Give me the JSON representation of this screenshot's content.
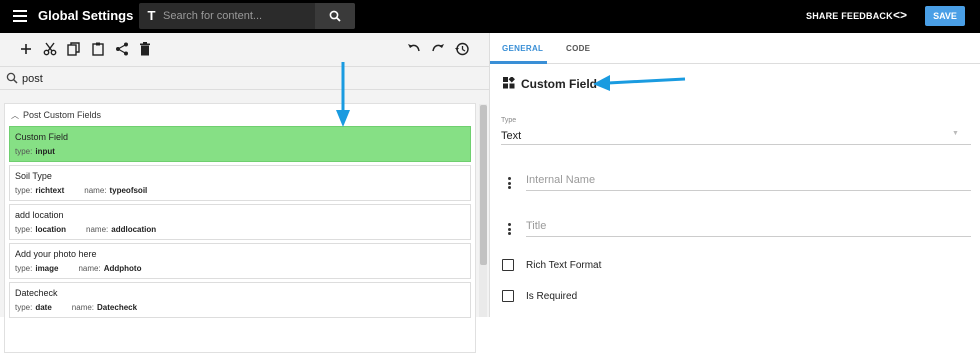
{
  "header": {
    "title": "Global Settings",
    "search_placeholder": "Search for content...",
    "share_feedback": "SHARE FEEDBACK",
    "code_toggle": "<>",
    "save_label": "SAVE"
  },
  "toolbar": {
    "icons": [
      "add-icon",
      "cut-icon",
      "copy-icon",
      "paste-icon",
      "share-icon",
      "delete-icon",
      "undo-icon",
      "redo-icon",
      "history-icon"
    ]
  },
  "filter": {
    "value": "post"
  },
  "tree": {
    "group_label": "Post Custom Fields",
    "type_key": "type:",
    "name_key": "name:",
    "items": [
      {
        "label": "Custom Field",
        "type": "input",
        "name": ""
      },
      {
        "label": "Soil Type",
        "type": "richtext",
        "name": "typeofsoil"
      },
      {
        "label": "add location",
        "type": "location",
        "name": "addlocation"
      },
      {
        "label": "Add your photo here",
        "type": "image",
        "name": "Addphoto"
      },
      {
        "label": "Datecheck",
        "type": "date",
        "name": "Datecheck"
      }
    ]
  },
  "details": {
    "tabs": [
      {
        "label": "GENERAL",
        "active": true
      },
      {
        "label": "CODE",
        "active": false
      }
    ],
    "title": "Custom Field",
    "type_label": "Type",
    "type_value": "Text",
    "internal_name_placeholder": "Internal Name",
    "title_placeholder": "Title",
    "rich_text_label": "Rich Text Format",
    "is_required_label": "Is Required"
  },
  "colors": {
    "accent": "#3a8fd6",
    "selected_item": "#86e085",
    "save_button": "#4a9fe6",
    "annotation_arrow": "#1a9be0"
  }
}
